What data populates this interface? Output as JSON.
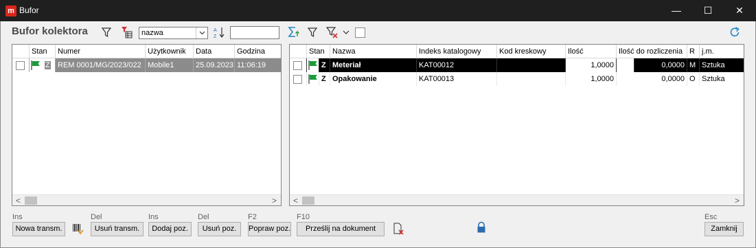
{
  "window": {
    "title": "Bufor",
    "app_icon_letter": "m",
    "min_glyph": "—",
    "max_glyph": "☐",
    "close_glyph": "✕"
  },
  "toolbar": {
    "heading": "Bufor kolektora",
    "sort_field_value": "nazwa",
    "search_value": ""
  },
  "left_grid": {
    "columns": [
      "",
      "Stan",
      "Numer",
      "Użytkownik",
      "Data",
      "Godzina"
    ],
    "rows": [
      {
        "stan": "Z",
        "numer": "REM 0001/MG/2023/022",
        "uzytkownik": "Mobile1",
        "data": "25.09.2023",
        "godzina": "11:06:19",
        "flag_color": "#1a9b3a",
        "selected": true
      }
    ]
  },
  "right_grid": {
    "columns": [
      "",
      "Stan",
      "Nazwa",
      "Indeks katalogowy",
      "Kod kreskowy",
      "Ilość",
      "Ilość do rozliczenia",
      "R",
      "j.m."
    ],
    "rows": [
      {
        "stan": "Z",
        "nazwa": "Meteriał",
        "indeks": "KAT00012",
        "kod": "",
        "ilosc": "1,0000",
        "do_rozliczenia": "0,0000",
        "r": "M",
        "jm": "Sztuka",
        "selected": true
      },
      {
        "stan": "Z",
        "nazwa": "Opakowanie",
        "indeks": "KAT00013",
        "kod": "",
        "ilosc": "1,0000",
        "do_rozliczenia": "0,0000",
        "r": "O",
        "jm": "Sztuka",
        "selected": false
      }
    ]
  },
  "scroll": {
    "left_arrow": "<",
    "right_arrow": ">"
  },
  "bottom": {
    "nowa": {
      "key": "Ins",
      "label": "Nowa transm."
    },
    "usun_transm": {
      "key": "Del",
      "label": "Usuń transm."
    },
    "dodaj": {
      "key": "Ins",
      "label": "Dodaj poz."
    },
    "usun_poz": {
      "key": "Del",
      "label": "Usuń poz."
    },
    "popraw": {
      "key": "F2",
      "label": "Popraw poz."
    },
    "przeslij": {
      "key": "F10",
      "label": "Prześlij na dokument"
    },
    "zamknij": {
      "key": "Esc",
      "label": "Zamknij"
    }
  },
  "colors": {
    "accent": "#1e88c8",
    "title_bg": "#1f1f1f",
    "flag": "#1a9b3a",
    "red_icon": "#d03030"
  }
}
